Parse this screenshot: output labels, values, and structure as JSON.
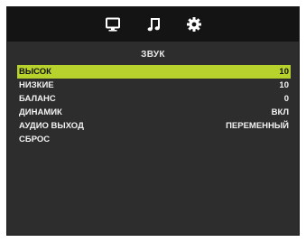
{
  "topbar": {
    "tabs": [
      {
        "icon": "monitor-icon"
      },
      {
        "icon": "music-note-icon"
      },
      {
        "icon": "gear-icon"
      }
    ]
  },
  "section": {
    "title": "ЗВУК"
  },
  "menu": {
    "selected_index": 0,
    "highlight_color": "#b7d22d",
    "items": [
      {
        "label": "ВЫСОК",
        "value": "10"
      },
      {
        "label": "НИЗКИЕ",
        "value": "10"
      },
      {
        "label": "БАЛАНС",
        "value": "0"
      },
      {
        "label": "ДИНАМИК",
        "value": "ВКЛ"
      },
      {
        "label": "АУДИО ВЫХОД",
        "value": "ПЕРЕМЕННЫЙ"
      },
      {
        "label": "СБРОС",
        "value": ""
      }
    ]
  }
}
